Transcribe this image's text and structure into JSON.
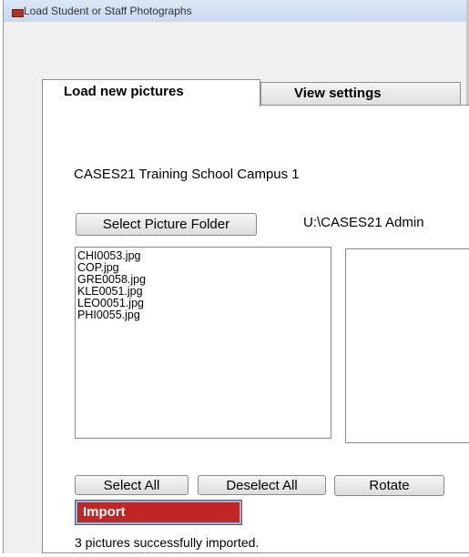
{
  "window": {
    "title": "Load Student or Staff Photographs"
  },
  "tabs": [
    {
      "label": "Load new pictures",
      "active": true
    },
    {
      "label": "View settings",
      "active": false
    }
  ],
  "school_name": "CASES21 Training School Campus 1",
  "select_folder_label": "Select Picture Folder",
  "folder_path": "U:\\CASES21 Admin",
  "files": [
    "CHI0053.jpg",
    "COP.jpg",
    "GRE0058.jpg",
    "KLE0051.jpg",
    "LEO0051.jpg",
    "PHI0055.jpg"
  ],
  "buttons": {
    "select_all": "Select All",
    "deselect_all": "Deselect All",
    "rotate": "Rotate",
    "import": "Import"
  },
  "status_text": "3 pictures successfully imported.",
  "colors": {
    "import_button": "#c12625",
    "window_bg": "#f0f0f0",
    "panel_bg": "#ffffff"
  }
}
